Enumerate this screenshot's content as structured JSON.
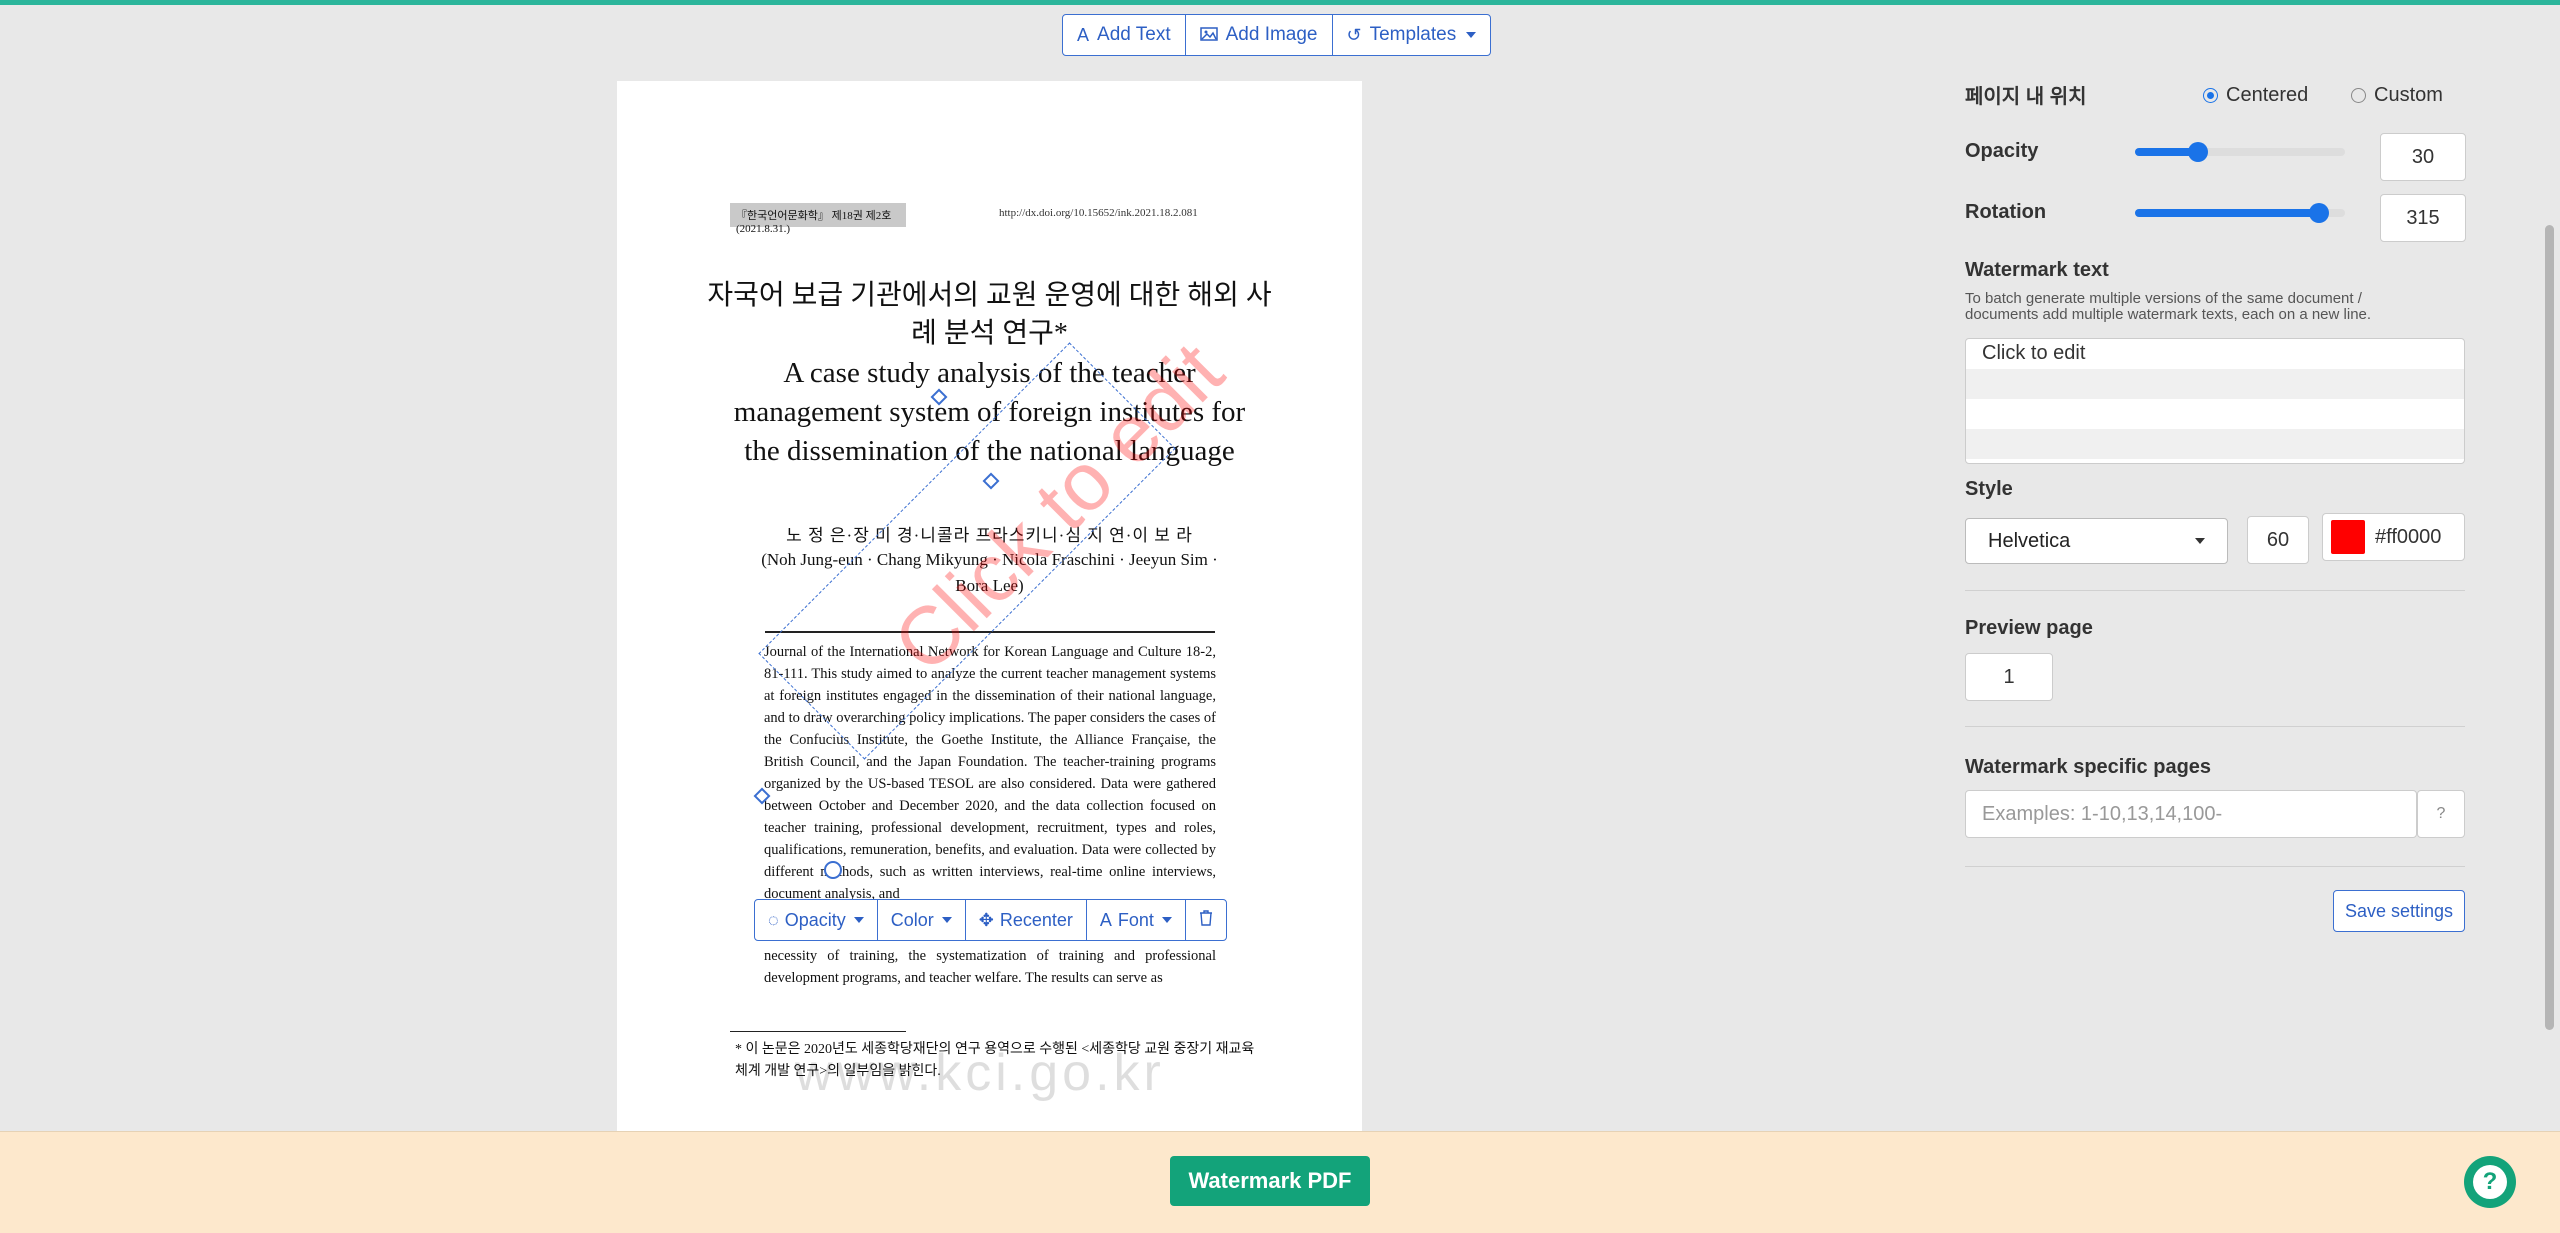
{
  "toolbar": {
    "add_text": "Add Text",
    "add_image": "Add Image",
    "templates": "Templates"
  },
  "document": {
    "journal_header": "『한국언어문화학』 제18권 제2호(2021.8.31.)",
    "doi": "http://dx.doi.org/10.15652/ink.2021.18.2.081",
    "title_ko": "자국어 보급 기관에서의 교원 운영에 대한 해외 사례 분석 연구*",
    "title_en": "A case study analysis of the teacher management system of foreign institutes for the dissemination of the national language",
    "authors_ko": "노 정 은·장 미 경·니콜라 프라스키니·심 지 연·이 보 라",
    "authors_en": "(Noh Jung-eun · Chang Mikyung · Nicola Fraschini · Jeeyun Sim · Bora Lee)",
    "abstract": "Journal of the International Network for Korean Language and Culture 18-2, 81-111. This study aimed to analyze the current teacher management systems at foreign institutes engaged in the dissemination of their national language, and to draw overarching policy implications. The paper considers the cases of the Confucius Institute, the Goethe Institute, the Alliance Française, the British Council, and the Japan Foundation. The teacher-training programs organized by the US-based TESOL are also considered. Data were gathered between October and December 2020, and the data collection focused on teacher training, professional development, recruitment, types and roles, qualifications, remuneration, benefits, and evaluation. Data were collected by different methods, such as written interviews, real-time online interviews, document analysis, and",
    "abstract_tail": "necessity of training, the systematization of training and professional development programs, and teacher welfare. The results can serve as",
    "footnote": "* 이 논문은 2020년도 세종학당재단의 연구 용역으로 수행된 <세종학당 교원 중장기 재교육 체계 개발 연구>의 일부임을 밝힌다.",
    "kci_watermark": "www.kci.go.kr",
    "watermark_preview": "Click to edit"
  },
  "float_toolbar": {
    "opacity": "Opacity",
    "color": "Color",
    "recenter": "Recenter",
    "font": "Font"
  },
  "panel": {
    "position_label": "페이지 내 위치",
    "centered": "Centered",
    "custom": "Custom",
    "opacity_label": "Opacity",
    "opacity_value": "30",
    "opacity_fraction": 0.3,
    "rotation_label": "Rotation",
    "rotation_value": "315",
    "rotation_fraction": 0.875,
    "wm_text_label": "Watermark text",
    "wm_text_help": "To batch generate multiple versions of the same document / documents add multiple watermark texts, each on a new line.",
    "wm_text_value": "Click to edit",
    "style_label": "Style",
    "font_value": "Helvetica",
    "font_size": "60",
    "color_value": "#ff0000",
    "preview_label": "Preview page",
    "preview_value": "1",
    "specific_label": "Watermark specific pages",
    "specific_placeholder": "Examples: 1-10,13,14,100-",
    "save_settings": "Save settings"
  },
  "footer": {
    "primary": "Watermark PDF"
  },
  "colors": {
    "accent": "#1a73e8",
    "primary_button": "#13a37a",
    "watermark": "#ff0000",
    "bottom_bar": "#fde8cc"
  }
}
